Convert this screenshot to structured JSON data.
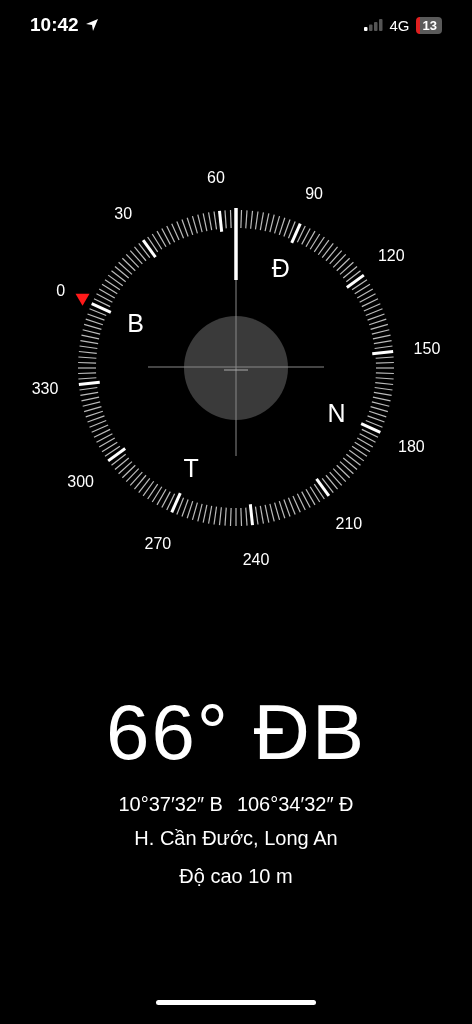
{
  "status_bar": {
    "time": "10:42",
    "network": "4G",
    "battery": "13"
  },
  "compass": {
    "degree_labels": [
      "0",
      "30",
      "60",
      "90",
      "120",
      "150",
      "180",
      "210",
      "240",
      "270",
      "300",
      "330"
    ],
    "cardinal_letters": [
      "B",
      "Đ",
      "N",
      "T"
    ]
  },
  "heading": "66° ĐB",
  "coordinates": {
    "latitude": "10°37′32″ B",
    "longitude": "106°34′32″ Đ"
  },
  "location": "H. Cần Đước, Long An",
  "altitude": "Độ cao 10 m"
}
